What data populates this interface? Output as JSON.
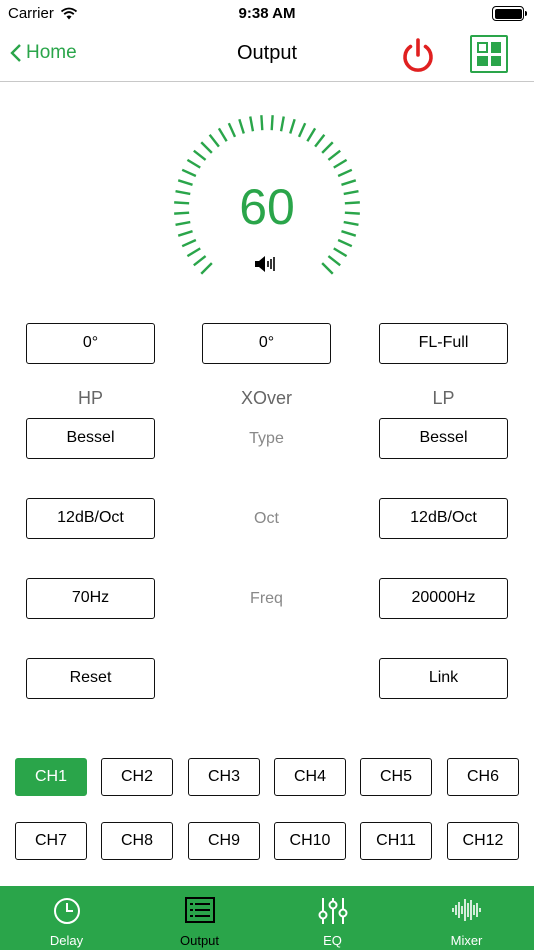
{
  "status_bar": {
    "carrier": "Carrier",
    "time": "9:38 AM"
  },
  "nav": {
    "back_label": "Home",
    "title": "Output"
  },
  "gauge": {
    "value": "60",
    "level": 0.6,
    "accent_color": "#2aa54a"
  },
  "top_row": {
    "left": "0°",
    "middle": "0°",
    "right": "FL-Full"
  },
  "headers": {
    "hp": "HP",
    "xover": "XOver",
    "lp": "LP"
  },
  "type": {
    "label": "Type",
    "hp": "Bessel",
    "lp": "Bessel"
  },
  "oct": {
    "label": "Oct",
    "hp": "12dB/Oct",
    "lp": "12dB/Oct"
  },
  "freq": {
    "label": "Freq",
    "hp": "70Hz",
    "lp": "20000Hz"
  },
  "actions": {
    "reset": "Reset",
    "link": "Link"
  },
  "channels": [
    "CH1",
    "CH2",
    "CH3",
    "CH4",
    "CH5",
    "CH6",
    "CH7",
    "CH8",
    "CH9",
    "CH10",
    "CH11",
    "CH12"
  ],
  "active_channel": "CH1",
  "tabs": [
    {
      "label": "Delay",
      "icon": "clock-icon"
    },
    {
      "label": "Output",
      "icon": "list-icon"
    },
    {
      "label": "EQ",
      "icon": "sliders-icon"
    },
    {
      "label": "Mixer",
      "icon": "waveform-icon"
    }
  ],
  "active_tab": "Output",
  "colors": {
    "accent": "#2aa54a",
    "power": "#e02020"
  }
}
